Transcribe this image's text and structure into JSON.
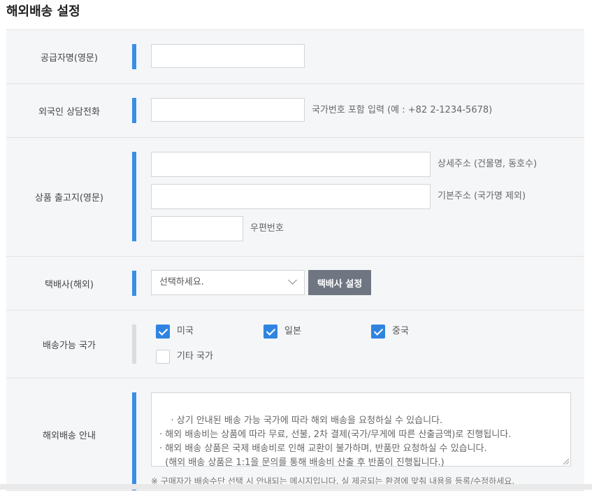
{
  "page": {
    "title": "해외배송 설정"
  },
  "rows": {
    "supplier": {
      "label": "공급자명(영문)",
      "value": ""
    },
    "phone": {
      "label": "외국인 상담전화",
      "value": "",
      "help": "국가번호 포함 입력 (예 : +82 2-1234-5678)"
    },
    "address": {
      "label": "상품 출고지(영문)",
      "detail_value": "",
      "detail_help": "상세주소 (건물명, 동호수)",
      "basic_value": "",
      "basic_help": "기본주소 (국가명 제외)",
      "zip_value": "",
      "zip_help": "우편번호"
    },
    "courier": {
      "label": "택배사(해외)",
      "select_value": "선택하세요.",
      "button_label": "택배사 설정"
    },
    "countries": {
      "label": "배송가능 국가",
      "options": [
        {
          "label": "미국",
          "checked": true
        },
        {
          "label": "일본",
          "checked": true
        },
        {
          "label": "중국",
          "checked": true
        },
        {
          "label": "기타 국가",
          "checked": false
        }
      ]
    },
    "guide": {
      "label": "해외배송 안내",
      "text": "· 상기 안내된 배송 가능 국가에 따라 해외 배송을 요청하실 수 있습니다.\n· 해외 배송비는 상품에 따라 무료, 선불, 2차 결제(국가/무게에 따른 산출금액)로 진행됩니다.\n· 해외 배송 상품은 국제 배송비로 인해 교환이 불가하며, 반품만 요청하실 수 있습니다.\n  (해외 배송 상품은 1:1을 문의를 통해 배송비 산출 후 반품이 진행됩니다.)",
      "note": "※ 구매자가 배송수단 선택 시 안내되는 메시지입니다. 실 제공되는 환경에 맞춰 내용을 등록/수정하세요."
    }
  }
}
